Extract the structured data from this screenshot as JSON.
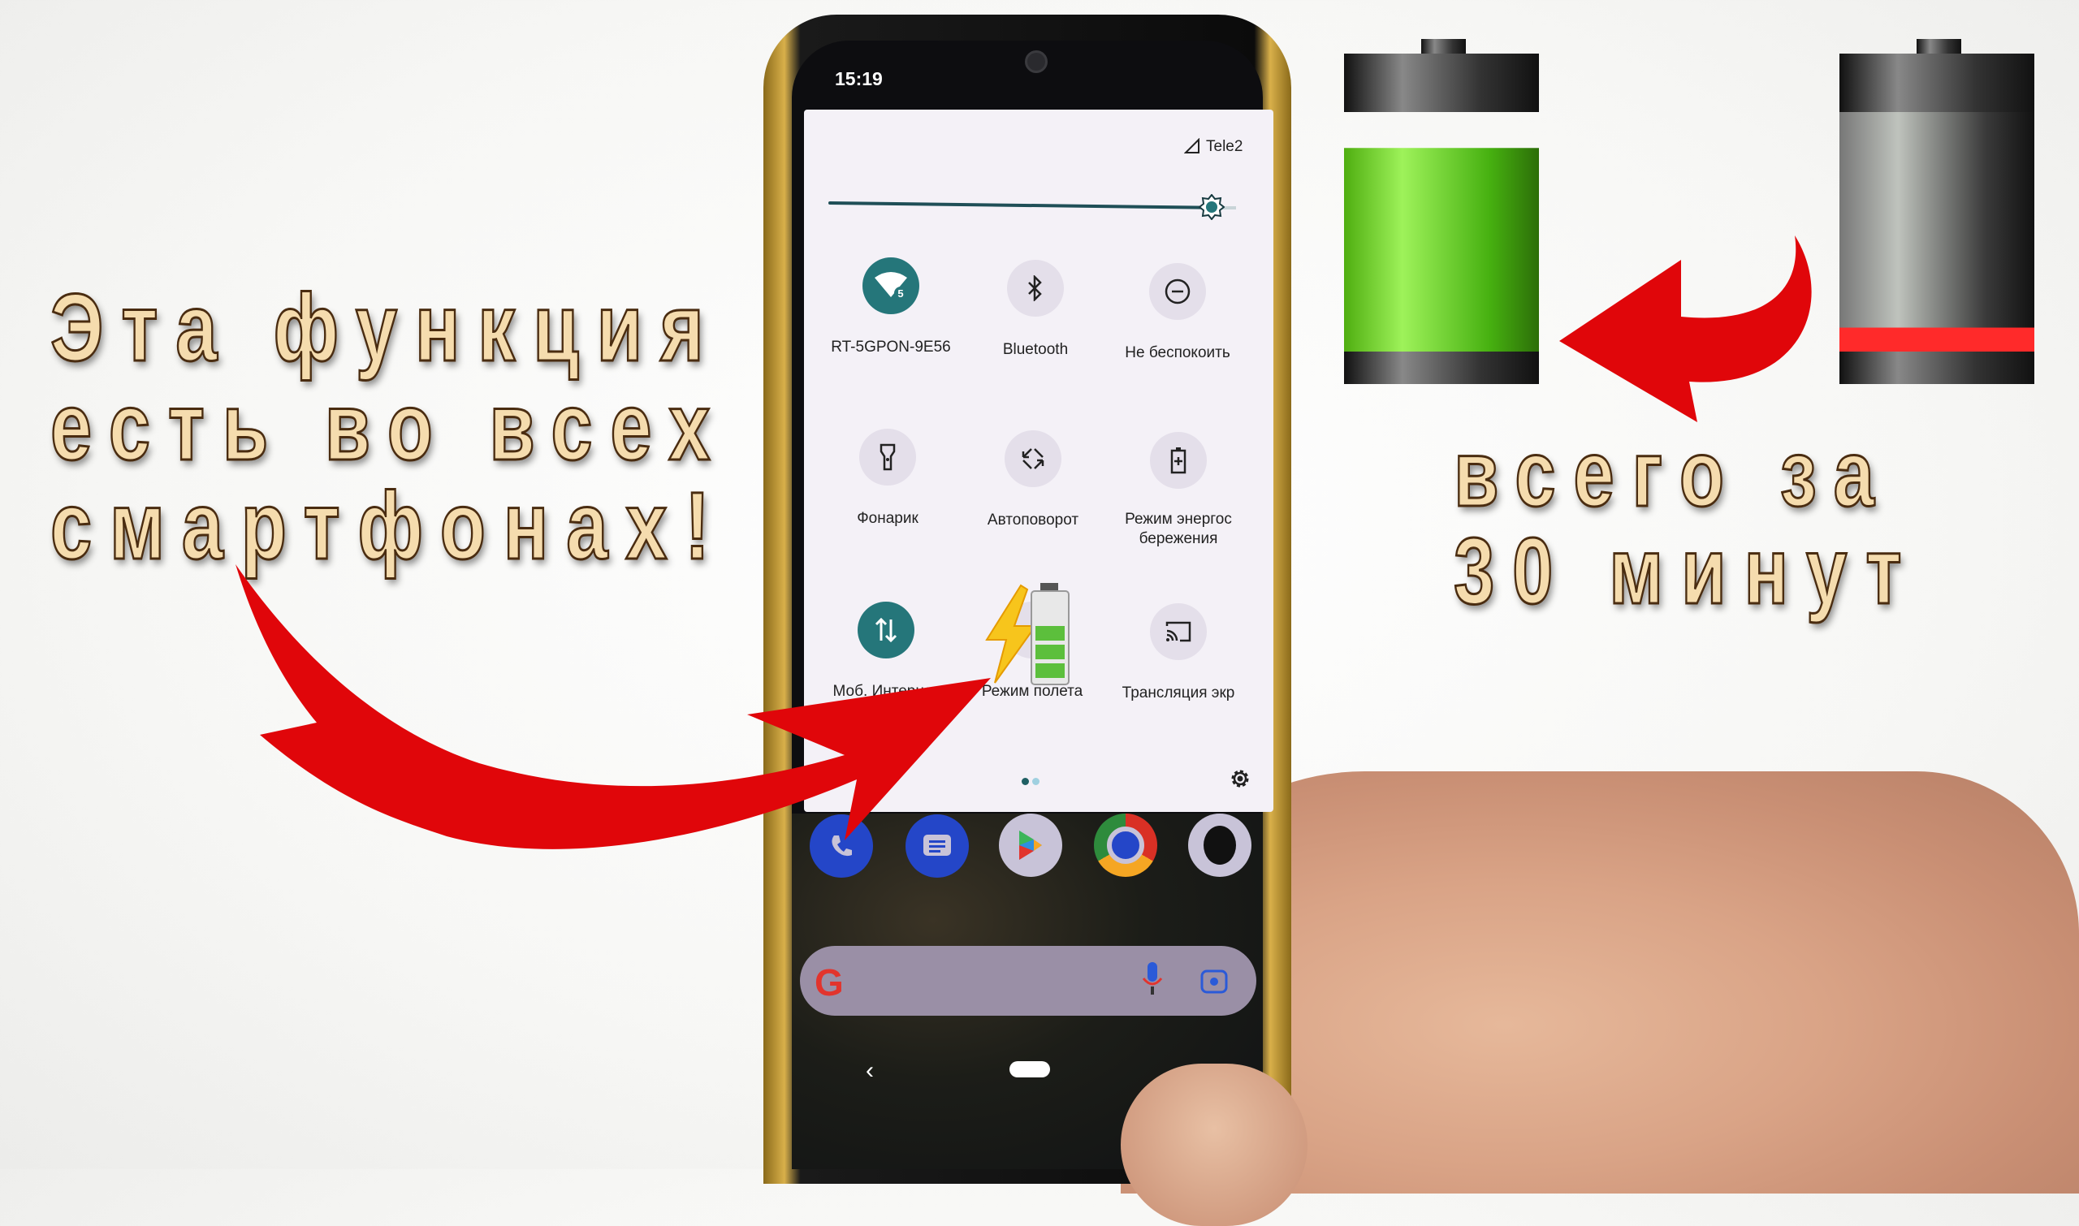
{
  "thumbnail": {
    "headline_left": [
      "Эта функция",
      "есть во всех",
      "смартфонах!"
    ],
    "headline_right": [
      "всего за",
      "30 минут"
    ]
  },
  "phone": {
    "status_bar": {
      "time": "15:19",
      "carrier": "Tele2"
    },
    "quick_settings": {
      "brightness_level": 0.95,
      "tiles": [
        {
          "label": "RT-5GPON-9E56",
          "icon": "wifi-5-icon",
          "active": true
        },
        {
          "label": "Bluetooth",
          "icon": "bluetooth-icon",
          "active": false
        },
        {
          "label": "Не беспокоить",
          "icon": "do-not-disturb-icon",
          "active": false
        },
        {
          "label": "Фонарик",
          "icon": "flashlight-icon",
          "active": false
        },
        {
          "label": "Автоповорот",
          "icon": "auto-rotate-icon",
          "active": false
        },
        {
          "label": "Режим энергос\nбережения",
          "icon": "battery-saver-icon",
          "active": false
        },
        {
          "label": "Моб. Интернет",
          "icon": "mobile-data-icon",
          "active": true
        },
        {
          "label": "Режим полета",
          "icon": "airplane-icon",
          "active": false
        },
        {
          "label": "Трансляция экр",
          "icon": "cast-icon",
          "active": false
        }
      ],
      "page_count": 2,
      "current_page": 1
    },
    "dock": [
      "phone-app",
      "messages-app",
      "play-store-app",
      "chrome-app",
      "camera-app"
    ],
    "search_bar": {
      "logo": "G"
    },
    "nav": {
      "back": "‹"
    }
  },
  "colors": {
    "accent": "#25767a",
    "headline_fill": "#f5dcae",
    "headline_stroke": "#4a2c10",
    "arrow": "#e0060a",
    "battery_full": "#5cc21a",
    "battery_low": "#ff2a2a",
    "page_dot_active": "#1f5f63",
    "page_dot_inactive": "#9fd0e0"
  },
  "art": {
    "full_battery": {
      "charge_fraction": 0.85
    },
    "empty_battery": {
      "charge_fraction": 0.1
    }
  }
}
